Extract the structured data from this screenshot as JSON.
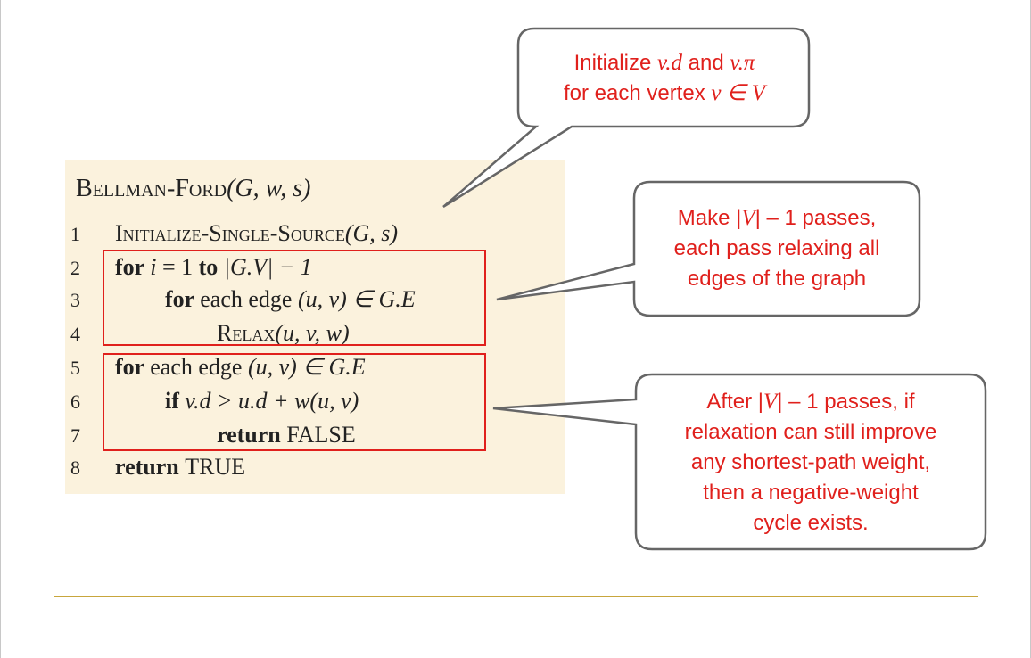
{
  "code": {
    "proc_name": "Bellman-Ford",
    "proc_args": "(G, w, s)",
    "lines": [
      {
        "num": "1",
        "parts": [
          {
            "t": "Initialize-Single-Source",
            "s": "sc"
          },
          {
            "t": "(G, s)",
            "s": "it"
          }
        ]
      },
      {
        "num": "2",
        "parts": [
          {
            "t": "for ",
            "s": "kw"
          },
          {
            "t": "i",
            "s": "it"
          },
          {
            "t": " = 1 ",
            "s": ""
          },
          {
            "t": "to ",
            "s": "kw"
          },
          {
            "t": "|G.V| − 1",
            "s": "it"
          }
        ]
      },
      {
        "num": "3",
        "parts": [
          {
            "t": "for ",
            "s": "kw"
          },
          {
            "t": "each edge ",
            "s": ""
          },
          {
            "t": "(u, v) ∈ G.E",
            "s": "it"
          }
        ]
      },
      {
        "num": "4",
        "parts": [
          {
            "t": "Relax",
            "s": "sc"
          },
          {
            "t": "(u, v, w)",
            "s": "it"
          }
        ]
      },
      {
        "num": "5",
        "parts": [
          {
            "t": "for ",
            "s": "kw"
          },
          {
            "t": "each edge ",
            "s": ""
          },
          {
            "t": "(u, v) ∈ G.E",
            "s": "it"
          }
        ]
      },
      {
        "num": "6",
        "parts": [
          {
            "t": "if ",
            "s": "kw"
          },
          {
            "t": "v.d > u.d + w(u, v)",
            "s": "it"
          }
        ]
      },
      {
        "num": "7",
        "parts": [
          {
            "t": "return ",
            "s": "kw"
          },
          {
            "t": "FALSE",
            "s": "sc"
          }
        ]
      },
      {
        "num": "8",
        "parts": [
          {
            "t": "return ",
            "s": "kw"
          },
          {
            "t": "TRUE",
            "s": "sc"
          }
        ]
      }
    ]
  },
  "callouts": {
    "init": {
      "line1_a": "Initialize ",
      "line1_m1": "v.d",
      "line1_b": " and ",
      "line1_m2": "v.π",
      "line2_a": "for each vertex ",
      "line2_m": "v ∈ V"
    },
    "passes": {
      "line1_a": "Make |",
      "line1_m": "V",
      "line1_b": "| – 1 passes,",
      "line2": "each pass relaxing all",
      "line3": "edges of the graph"
    },
    "cycle": {
      "line1_a": "After |",
      "line1_m": "V",
      "line1_b": "| – 1 passes, if",
      "line2": "relaxation can still improve",
      "line3": "any shortest-path weight,",
      "line4": "then a negative-weight",
      "line5": "cycle exists."
    }
  },
  "colors": {
    "accent_red": "#e0201c",
    "panel_bg": "#fbf2dd",
    "divider": "#c8a63c"
  }
}
